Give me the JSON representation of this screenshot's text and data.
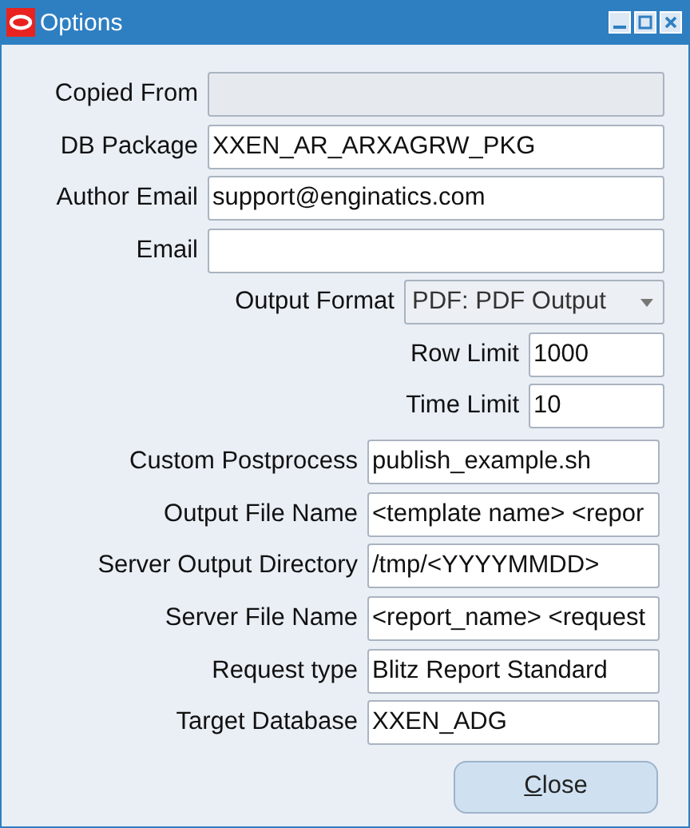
{
  "window": {
    "title": "Options"
  },
  "sections": [
    {
      "fields": [
        {
          "label": "Copied From",
          "kind": "text",
          "disabled": true
        },
        {
          "label": "DB Package",
          "kind": "text",
          "value": "XXEN_AR_ARXAGRW_PKG",
          "disabled": false
        },
        {
          "label": "Author Email",
          "kind": "text",
          "value": "support@enginatics.com",
          "disabled": false
        },
        {
          "label": "Email",
          "kind": "text",
          "disabled": false
        }
      ]
    },
    {
      "fields": [
        {
          "label": "Output Format",
          "kind": "dropdown",
          "value": "PDF: PDF Output"
        }
      ]
    },
    {
      "fields": [
        {
          "label": "Row Limit",
          "kind": "text",
          "value": "1000",
          "disabled": false
        },
        {
          "label": "Time Limit",
          "kind": "text",
          "value": "10",
          "disabled": false
        }
      ]
    },
    {
      "fields": [
        {
          "label": "Custom Postprocess",
          "kind": "text",
          "value": "publish_example.sh",
          "disabled": false
        },
        {
          "label": "Output File Name",
          "kind": "text",
          "value": "<template name> <repor",
          "disabled": false
        },
        {
          "label": "Server Output Directory",
          "kind": "text",
          "value": "/tmp/<YYYYMMDD>",
          "disabled": false
        },
        {
          "label": "Server File Name",
          "kind": "text",
          "value": "<report_name> <request",
          "disabled": false
        },
        {
          "label": "Request type",
          "kind": "text",
          "value": "Blitz Report Standard",
          "disabled": false
        },
        {
          "label": "Target Database",
          "kind": "text",
          "value": "XXEN_ADG",
          "disabled": false
        }
      ]
    }
  ],
  "buttons": [
    {
      "label": "Close"
    }
  ]
}
